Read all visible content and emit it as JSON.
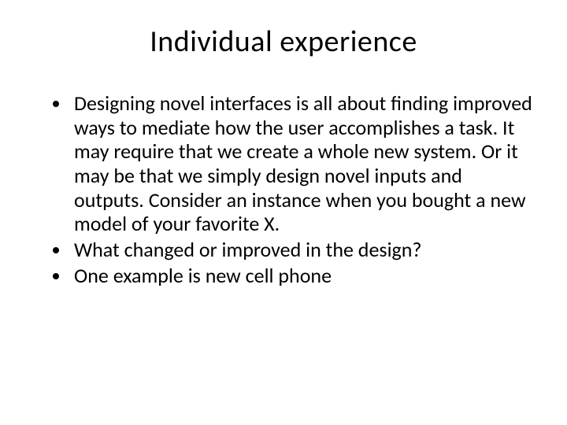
{
  "slide": {
    "title": "Individual experience",
    "bullets": [
      "Designing novel interfaces is all about finding improved ways to mediate how the user accomplishes a task. It may require that we create a whole new system. Or it may be that we simply design novel inputs and outputs. Consider an instance when you bought a new model of your favorite X.",
      "What changed or improved in the design?",
      "One example is new cell phone"
    ]
  }
}
